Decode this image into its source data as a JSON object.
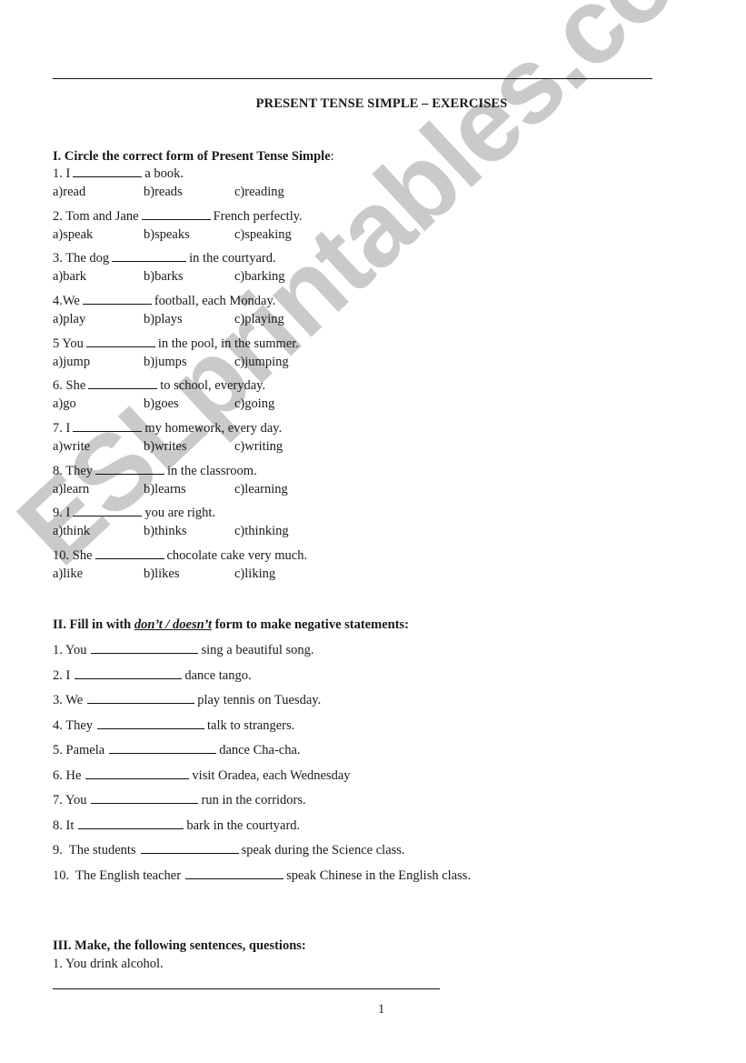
{
  "document": {
    "title": "PRESENT TENSE SIMPLE – EXERCISES",
    "page_number": "1",
    "watermark": "ESLprintables.com"
  },
  "section1": {
    "heading_bold": "I. Circle the correct form of Present Tense Simple",
    "heading_tail": ":",
    "items": [
      {
        "pre": "1. I",
        "post": "a book.",
        "a": "a)read",
        "b": "b)reads",
        "c": "c)reading"
      },
      {
        "pre": "2. Tom and Jane",
        "post": "French perfectly.",
        "a": "a)speak",
        "b": "b)speaks",
        "c": "c)speaking"
      },
      {
        "pre": "3. The dog",
        "post": "in the courtyard.",
        "a": "a)bark",
        "b": "b)barks",
        "c": "c)barking"
      },
      {
        "pre": "4.We",
        "post": "football, each Monday.",
        "a": "a)play",
        "b": "b)plays",
        "c": "c)playing"
      },
      {
        "pre": "5 You",
        "post": "in the pool, in the summer.",
        "a": "a)jump",
        "b": "b)jumps",
        "c": "c)jumping"
      },
      {
        "pre": "6. She",
        "post": "to school, everyday.",
        "a": "a)go",
        "b": "b)goes",
        "c": "c)going"
      },
      {
        "pre": "7. I",
        "post": "my homework, every day.",
        "a": "a)write",
        "b": "b)writes",
        "c": "c)writing"
      },
      {
        "pre": "8. They",
        "post": "in the classroom.",
        "a": "a)learn",
        "b": "b)learns",
        "c": "c)learning"
      },
      {
        "pre": "9. I",
        "post": "you are right.",
        "a": "a)think",
        "b": "b)thinks",
        "c": "c)thinking"
      },
      {
        "pre": "10. She",
        "post": "chocolate cake very much.",
        "a": "a)like",
        "b": "b)likes",
        "c": "c)liking"
      }
    ]
  },
  "section2": {
    "heading_pre": "II. Fill in with ",
    "heading_emph": "don’t / doesn’t",
    "heading_post": " form to make negative statements:",
    "items": [
      {
        "pre": "1. You",
        "post": "sing a beautiful song."
      },
      {
        "pre": "2. I",
        "post": "dance tango."
      },
      {
        "pre": "3. We",
        "post": "play tennis on Tuesday."
      },
      {
        "pre": "4. They",
        "post": "talk to strangers."
      },
      {
        "pre": "5. Pamela",
        "post": "dance Cha-cha."
      },
      {
        "pre": "6. He",
        "post": "visit Oradea, each Wednesday"
      },
      {
        "pre": "7. You",
        "post": "run in the corridors."
      },
      {
        "pre": "8. It",
        "post": "bark in the courtyard."
      },
      {
        "pre": "9.  The students",
        "post": "speak during the Science class."
      },
      {
        "pre": "10.  The English teacher",
        "post": "speak Chinese in the English class."
      }
    ]
  },
  "section3": {
    "heading": "III. Make, the following sentences, questions:",
    "items": [
      {
        "text": "1. You drink alcohol."
      }
    ]
  }
}
